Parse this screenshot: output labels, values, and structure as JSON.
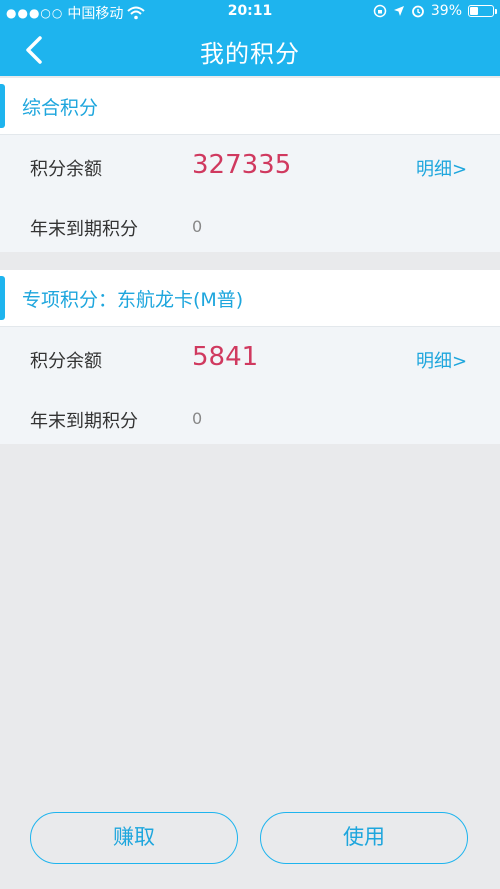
{
  "status_bar": {
    "signal": "●●●○○",
    "carrier": "中国移动",
    "time": "20:11",
    "battery": "39%",
    "battery_level": 0.39
  },
  "navbar": {
    "title": "我的积分",
    "back_icon": "chevron-left-icon"
  },
  "sections": [
    {
      "title": "综合积分",
      "balance_label": "积分余额",
      "balance_value": "327335",
      "detail_label": "明细>",
      "expiring_label": "年末到期积分",
      "expiring_value": "0"
    },
    {
      "title": "专项积分：东航龙卡(M普)",
      "balance_label": "积分余额",
      "balance_value": "5841",
      "detail_label": "明细>",
      "expiring_label": "年末到期积分",
      "expiring_value": "0"
    }
  ],
  "actions": {
    "earn_label": "赚取",
    "use_label": "使用"
  },
  "colors": {
    "accent": "#1eb4ee",
    "value": "#d0395f",
    "background": "#e9eaec"
  }
}
